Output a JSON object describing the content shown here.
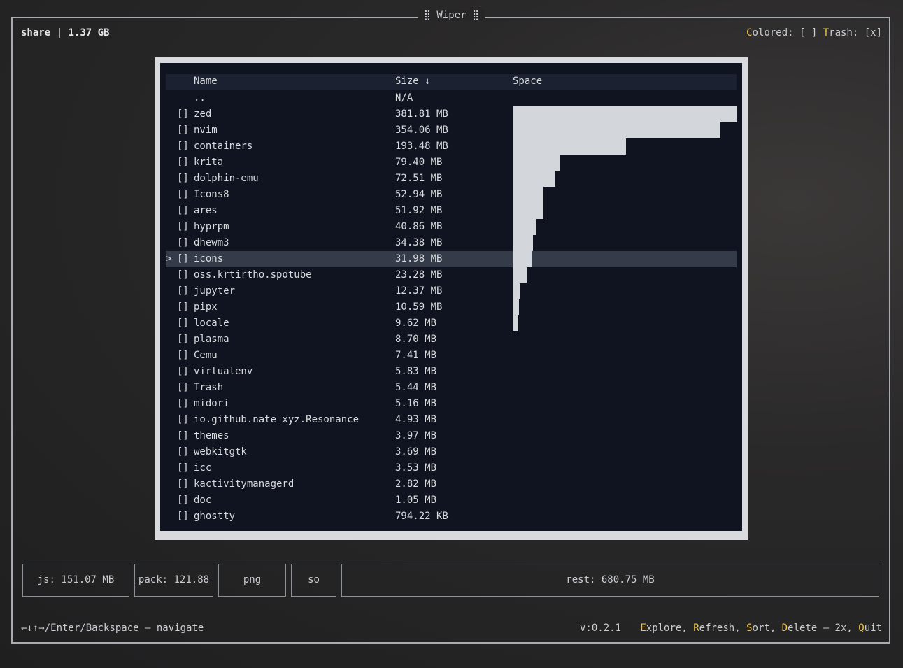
{
  "window": {
    "title": "⣿ Wiper ⣿"
  },
  "header": {
    "path": "share",
    "separator": "|",
    "total_size": "1.37 GB",
    "colored_key": "C",
    "colored_rest": "olored: [ ]",
    "trash_key": "T",
    "trash_rest": "rash: [x]"
  },
  "table": {
    "columns": {
      "name": "Name",
      "size": "Size ↓",
      "space": "Space"
    },
    "selected_index": 10,
    "rows": [
      {
        "check": "",
        "name": "..",
        "size": "N/A",
        "mb": 0
      },
      {
        "check": "[]",
        "name": "zed",
        "size": "381.81 MB",
        "mb": 381.81
      },
      {
        "check": "[]",
        "name": "nvim",
        "size": "354.06 MB",
        "mb": 354.06
      },
      {
        "check": "[]",
        "name": "containers",
        "size": "193.48 MB",
        "mb": 193.48
      },
      {
        "check": "[]",
        "name": "krita",
        "size": "79.40 MB",
        "mb": 79.4
      },
      {
        "check": "[]",
        "name": "dolphin-emu",
        "size": "72.51 MB",
        "mb": 72.51
      },
      {
        "check": "[]",
        "name": "Icons8",
        "size": "52.94 MB",
        "mb": 52.94
      },
      {
        "check": "[]",
        "name": "ares",
        "size": "51.92 MB",
        "mb": 51.92
      },
      {
        "check": "[]",
        "name": "hyprpm",
        "size": "40.86 MB",
        "mb": 40.86
      },
      {
        "check": "[]",
        "name": "dhewm3",
        "size": "34.38 MB",
        "mb": 34.38
      },
      {
        "check": "[]",
        "name": "icons",
        "size": "31.98 MB",
        "mb": 31.98
      },
      {
        "check": "[]",
        "name": "oss.krtirtho.spotube",
        "size": "23.28 MB",
        "mb": 23.28
      },
      {
        "check": "[]",
        "name": "jupyter",
        "size": "12.37 MB",
        "mb": 12.37
      },
      {
        "check": "[]",
        "name": "pipx",
        "size": "10.59 MB",
        "mb": 10.59
      },
      {
        "check": "[]",
        "name": "locale",
        "size": "9.62 MB",
        "mb": 9.62
      },
      {
        "check": "[]",
        "name": "plasma",
        "size": "8.70 MB",
        "mb": 8.7
      },
      {
        "check": "[]",
        "name": "Cemu",
        "size": "7.41 MB",
        "mb": 7.41
      },
      {
        "check": "[]",
        "name": "virtualenv",
        "size": "5.83 MB",
        "mb": 5.83
      },
      {
        "check": "[]",
        "name": "Trash",
        "size": "5.44 MB",
        "mb": 5.44
      },
      {
        "check": "[]",
        "name": "midori",
        "size": "5.16 MB",
        "mb": 5.16
      },
      {
        "check": "[]",
        "name": "io.github.nate_xyz.Resonance",
        "size": "4.93 MB",
        "mb": 4.93
      },
      {
        "check": "[]",
        "name": "themes",
        "size": "3.97 MB",
        "mb": 3.97
      },
      {
        "check": "[]",
        "name": "webkitgtk",
        "size": "3.69 MB",
        "mb": 3.69
      },
      {
        "check": "[]",
        "name": "icc",
        "size": "3.53 MB",
        "mb": 3.53
      },
      {
        "check": "[]",
        "name": "kactivitymanagerd",
        "size": "2.82 MB",
        "mb": 2.82
      },
      {
        "check": "[]",
        "name": "doc",
        "size": "1.05 MB",
        "mb": 1.05
      },
      {
        "check": "[]",
        "name": "ghostty",
        "size": "794.22 KB",
        "mb": 0.79
      }
    ]
  },
  "extensions": [
    {
      "label": "js: 151.07 MB"
    },
    {
      "label": "pack: 121.88"
    },
    {
      "label": "png"
    },
    {
      "label": "so"
    },
    {
      "label": "rest: 680.75 MB"
    }
  ],
  "footer": {
    "nav_hint": "←↓↑→/Enter/Backspace – navigate",
    "version": "v:0.2.1",
    "actions": [
      {
        "key": "E",
        "rest": "xplore",
        "sep": ", "
      },
      {
        "key": "R",
        "rest": "efresh",
        "sep": ", "
      },
      {
        "key": "S",
        "rest": "ort",
        "sep": ", "
      },
      {
        "key": "D",
        "rest": "elete – 2x",
        "sep": ", "
      },
      {
        "key": "Q",
        "rest": "uit",
        "sep": ""
      }
    ]
  },
  "colors": {
    "hotkey": "#f0c742",
    "bar": "#d3d6db",
    "selected_row": "#353c49"
  }
}
